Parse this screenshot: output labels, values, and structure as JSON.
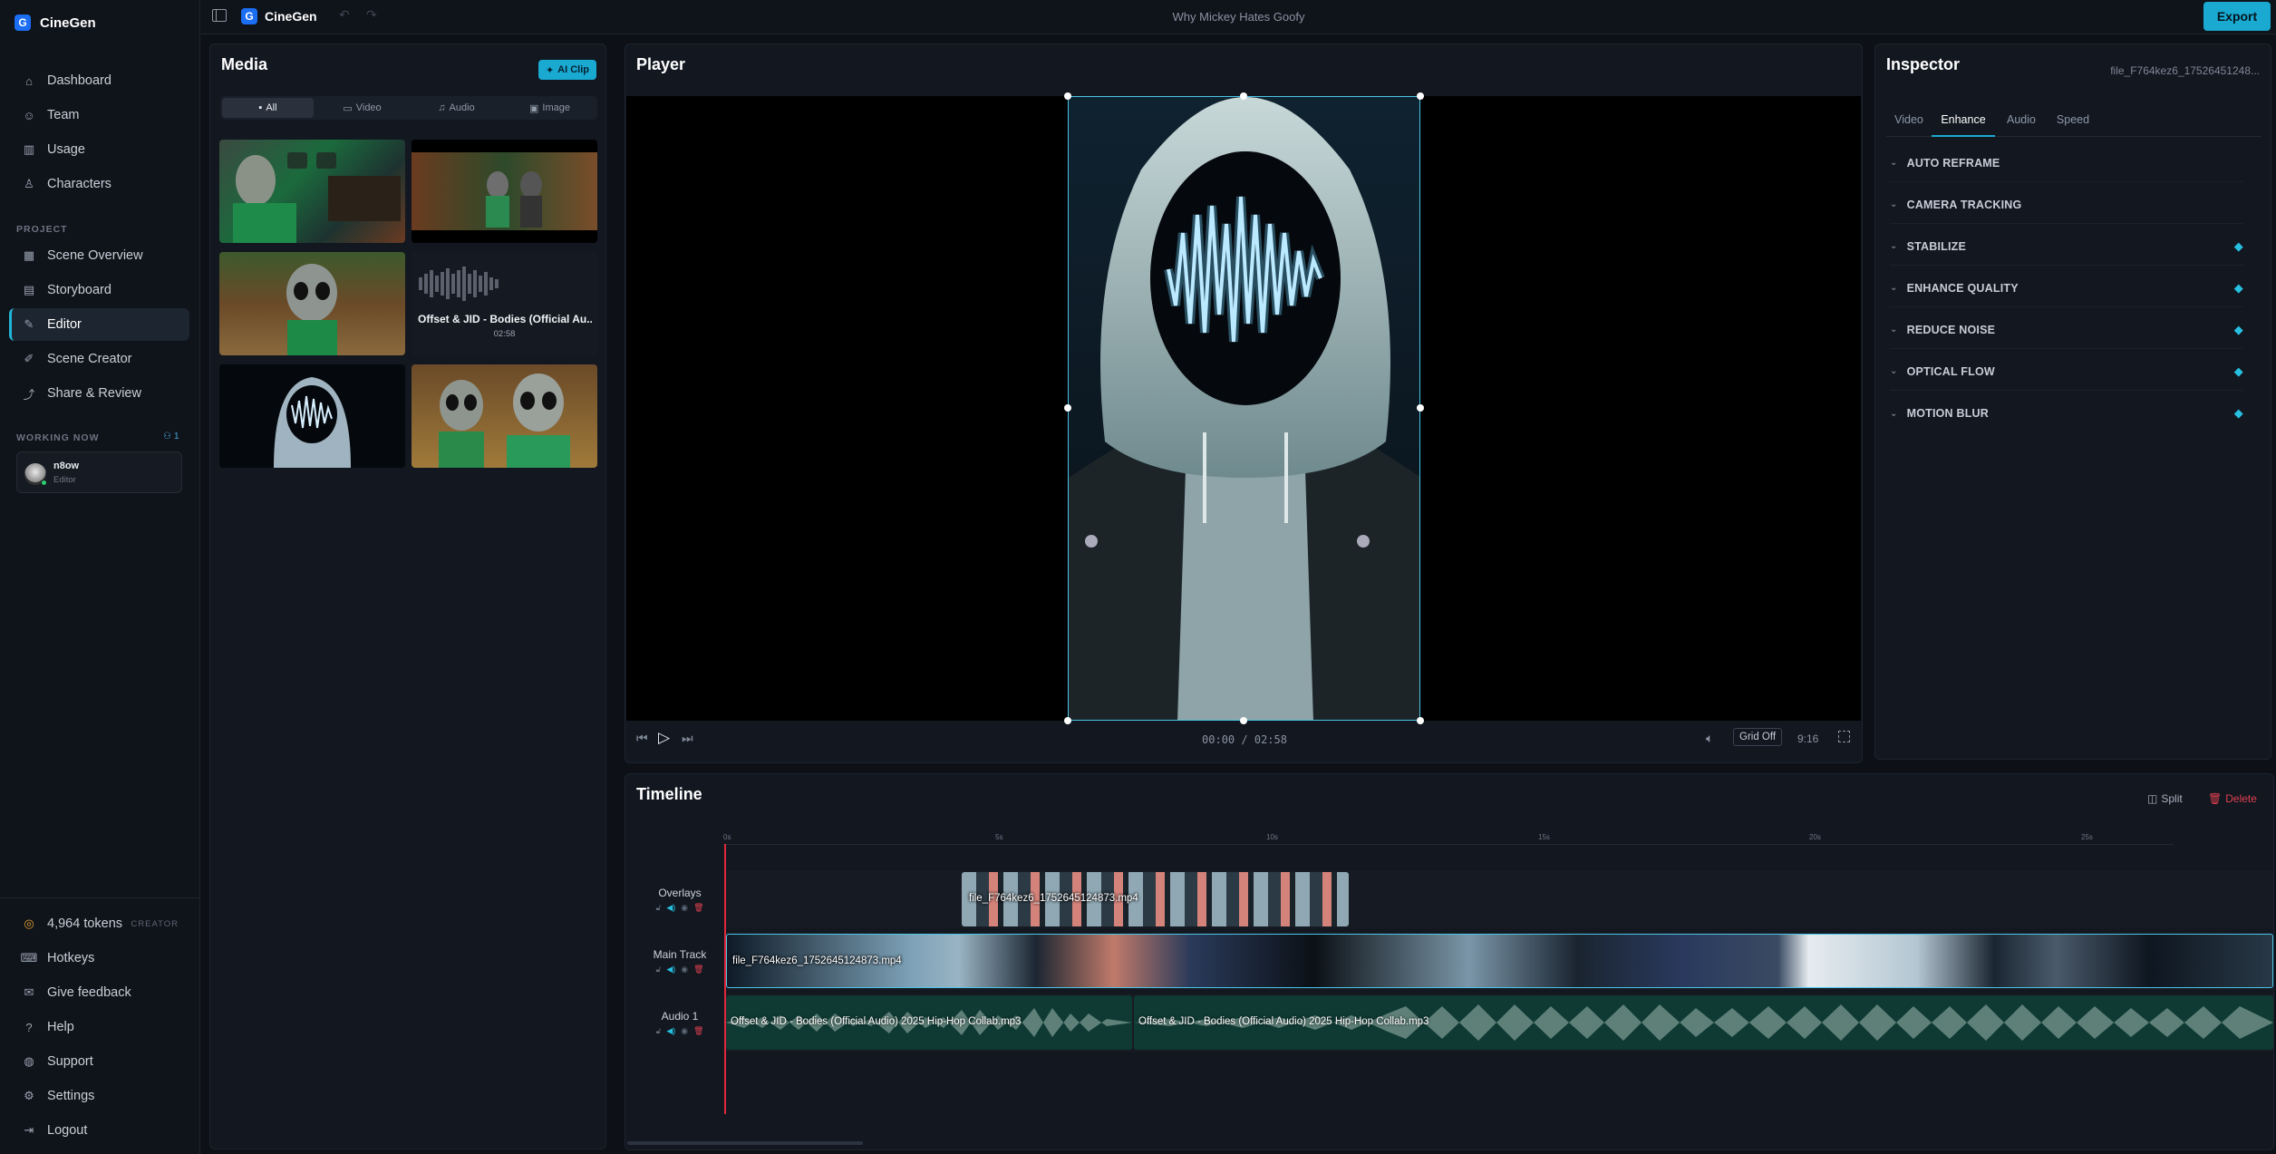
{
  "app": {
    "name": "CineGen",
    "logo_letter": "G",
    "project_title": "Why Mickey Hates Goofy",
    "export_label": "Export"
  },
  "sidebar": {
    "nav": [
      {
        "label": "Dashboard",
        "icon": "home-icon"
      },
      {
        "label": "Team",
        "icon": "user-icon"
      },
      {
        "label": "Usage",
        "icon": "chart-icon"
      },
      {
        "label": "Characters",
        "icon": "person-icon"
      }
    ],
    "project_label": "PROJECT",
    "project_nav": [
      {
        "label": "Scene Overview",
        "icon": "scene-icon"
      },
      {
        "label": "Storyboard",
        "icon": "storyboard-icon"
      },
      {
        "label": "Editor",
        "icon": "edit-icon",
        "active": true
      },
      {
        "label": "Scene Creator",
        "icon": "pen-icon"
      },
      {
        "label": "Share & Review",
        "icon": "share-icon"
      }
    ],
    "working_now_label": "WORKING NOW",
    "working_count": "1",
    "user": {
      "name": "n8ow",
      "role": "Editor"
    },
    "tokens": "4,964 tokens",
    "plan": "CREATOR",
    "bottom_nav": [
      {
        "label": "Hotkeys",
        "icon": "keyboard-icon"
      },
      {
        "label": "Give feedback",
        "icon": "feedback-icon"
      },
      {
        "label": "Help",
        "icon": "help-icon"
      },
      {
        "label": "Support",
        "icon": "support-icon"
      },
      {
        "label": "Settings",
        "icon": "gear-icon"
      },
      {
        "label": "Logout",
        "icon": "logout-icon"
      }
    ]
  },
  "media": {
    "title": "Media",
    "ai_clip_label": "AI Clip",
    "filters": [
      "All",
      "Video",
      "Audio",
      "Image"
    ],
    "audio_item": {
      "name": "Offset & JID - Bodies (Official Au...",
      "duration": "02:58"
    }
  },
  "player": {
    "title": "Player",
    "time_current": "00:00",
    "time_total": "02:58",
    "grid_label": "Grid Off",
    "aspect": "9:16"
  },
  "inspector": {
    "title": "Inspector",
    "file_name": "file_F764kez6_17526451248...",
    "tabs": [
      "Video",
      "Enhance",
      "Audio",
      "Speed"
    ],
    "active_tab": "Enhance",
    "sections": [
      {
        "label": "AUTO REFRAME",
        "premium": false
      },
      {
        "label": "CAMERA TRACKING",
        "premium": false
      },
      {
        "label": "STABILIZE",
        "premium": true
      },
      {
        "label": "ENHANCE QUALITY",
        "premium": true
      },
      {
        "label": "REDUCE NOISE",
        "premium": true
      },
      {
        "label": "OPTICAL FLOW",
        "premium": true
      },
      {
        "label": "MOTION BLUR",
        "premium": true
      }
    ]
  },
  "timeline": {
    "title": "Timeline",
    "split_label": "Split",
    "delete_label": "Delete",
    "ruler": [
      "0s",
      "5s",
      "10s",
      "15s",
      "20s",
      "25s"
    ],
    "tracks": [
      {
        "name": "Overlays",
        "clip": "file_F764kez6_17526451248​73.mp4"
      },
      {
        "name": "Main Track",
        "clip": "file_F764kez6_17526451248​73.mp4"
      },
      {
        "name": "Audio 1",
        "clip_a": "Offset & JID - Bodies (Official Audio) 2025 Hip-Hop Collab.mp3",
        "clip_b": "Offset & JID - Bodies (Official Audio) 2025 Hip-Hop Collab.mp3"
      }
    ]
  },
  "colors": {
    "accent": "#19a9d1",
    "playhead": "#e0283c",
    "delete": "#e04050",
    "premium": "#27c0e0"
  }
}
